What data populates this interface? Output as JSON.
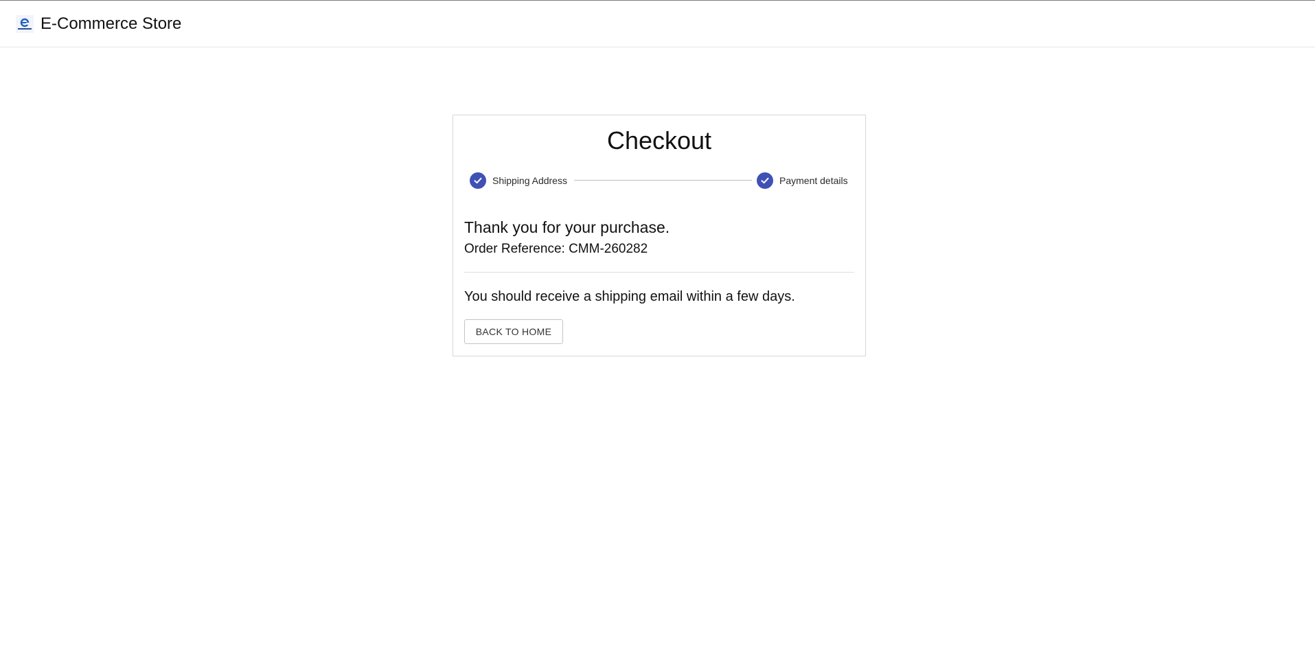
{
  "app": {
    "title": "E-Commerce Store",
    "logo_icon": "ecommerce-logo-icon"
  },
  "checkout": {
    "title": "Checkout",
    "steps": [
      {
        "label": "Shipping Address",
        "status": "completed",
        "icon": "check-icon"
      },
      {
        "label": "Payment details",
        "status": "completed",
        "icon": "check-icon"
      }
    ],
    "thank_you": "Thank you for your purchase.",
    "order_reference": "Order Reference: CMM-260282",
    "shipping_message": "You should receive a shipping email within a few days.",
    "back_button_label": "BACK TO HOME"
  },
  "colors": {
    "accent": "#3f51b5",
    "text": "#111111",
    "border": "#d9d9d9"
  }
}
